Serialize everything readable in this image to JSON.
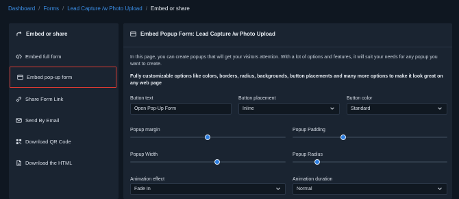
{
  "breadcrumb": {
    "items": [
      "Dashboard",
      "Forms",
      "Lead Capture /w Photo Upload"
    ],
    "current": "Embed or share"
  },
  "sidebar": {
    "title": "Embed or share",
    "items": [
      {
        "label": "Embed full form",
        "icon": "code-icon"
      },
      {
        "label": "Embed pop-up form",
        "icon": "window-icon",
        "active": true
      },
      {
        "label": "Share Form Link",
        "icon": "link-icon"
      },
      {
        "label": "Send By Email",
        "icon": "envelope-icon"
      },
      {
        "label": "Download QR Code",
        "icon": "qr-code-icon"
      },
      {
        "label": "Download the HTML",
        "icon": "file-icon"
      }
    ]
  },
  "main": {
    "title": "Embed Popup Form: Lead Capture /w Photo Upload",
    "intro": "In this page, you can create popups that will get your visitors attention. With a lot of options and features, it will suit your needs for any popup you want to create.",
    "intro_bold": "Fully customizable options like colors, borders, radius, backgrounds, button placements and many more options to make it look great on any web page",
    "button_text": {
      "label": "Button text",
      "value": "Open Pop-Up Form"
    },
    "button_placement": {
      "label": "Button placement",
      "value": "Inline"
    },
    "button_color": {
      "label": "Button color",
      "value": "Standard"
    },
    "popup_margin": {
      "label": "Popup margin",
      "level": 0.5
    },
    "popup_padding": {
      "label": "Popup Padding",
      "level": 0.33
    },
    "popup_width": {
      "label": "Popup Width",
      "level": 0.56
    },
    "popup_radius": {
      "label": "Popup Radius",
      "level": 0.16
    },
    "animation_effect": {
      "label": "Animation effect",
      "value": "Fade In"
    },
    "animation_duration": {
      "label": "Animation duration",
      "value": "Normal"
    }
  },
  "colors": {
    "background": "#0f1721",
    "panel": "#1a2431",
    "accent": "#2d7ee0",
    "link": "#3b8ee6",
    "active_outline": "#d93a32"
  }
}
